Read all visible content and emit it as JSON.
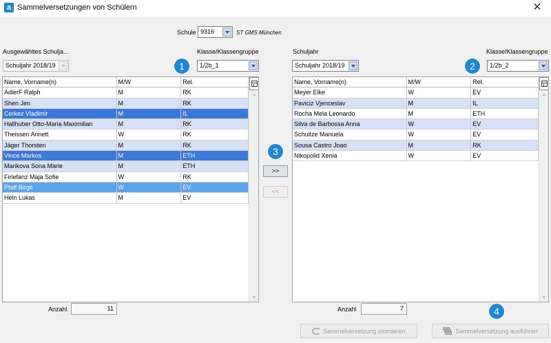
{
  "window": {
    "title": "Sammelversetzungen von Schülern",
    "app_icon_letter": "a",
    "close_glyph": "✕"
  },
  "school": {
    "label": "Schule",
    "value": "9316",
    "name": "ST GMS München"
  },
  "left": {
    "year_label": "Ausgewähltes Schulja...",
    "year_value": "Schuljahr 2018/19",
    "class_label": "Klasse/Klassengruppe",
    "class_value": "1/2b_1",
    "columns": [
      "Name, Vorname(n)",
      "M/W",
      "Rel."
    ],
    "rows": [
      {
        "name": "AdlerF Ralph",
        "mw": "M",
        "rel": "RK",
        "state": "white"
      },
      {
        "name": "Shen Jen",
        "mw": "M",
        "rel": "RK",
        "state": "light"
      },
      {
        "name": "Cerkez Vladimir",
        "mw": "M",
        "rel": "IL",
        "state": "sel"
      },
      {
        "name": "Hallhuber Otto-Maria Maximilian",
        "mw": "M",
        "rel": "RK",
        "state": "light"
      },
      {
        "name": "Theissen Annett",
        "mw": "W",
        "rel": "RK",
        "state": "white"
      },
      {
        "name": "Jäger Thorsten",
        "mw": "M",
        "rel": "RK",
        "state": "light"
      },
      {
        "name": "Vince Markos",
        "mw": "M",
        "rel": "ETH",
        "state": "sel"
      },
      {
        "name": "Marikova Sona Marie",
        "mw": "M",
        "rel": "ETH",
        "state": "light"
      },
      {
        "name": "Firlefanz Maja Sofie",
        "mw": "W",
        "rel": "RK",
        "state": "white"
      },
      {
        "name": "Pfaff Birgit",
        "mw": "W",
        "rel": "EV",
        "state": "focus"
      },
      {
        "name": "Hein Lukas",
        "mw": "M",
        "rel": "EV",
        "state": "white"
      }
    ],
    "count_label": "Anzahl",
    "count_value": "11"
  },
  "right": {
    "year_label": "Schuljahr",
    "year_value": "Schuljahr 2018/19",
    "class_label": "Klasse/Klassengruppe",
    "class_value": "1/2b_2",
    "columns": [
      "Name, Vorname(n)",
      "M/W",
      "Rel."
    ],
    "rows": [
      {
        "name": "Meyer Elke",
        "mw": "W",
        "rel": "EV",
        "state": "white"
      },
      {
        "name": "Paviciz Vjenceslav",
        "mw": "M",
        "rel": "IL",
        "state": "light"
      },
      {
        "name": "Rocha Mela Leonardo",
        "mw": "M",
        "rel": "ETH",
        "state": "white"
      },
      {
        "name": "Silva de Barbossa Anna",
        "mw": "W",
        "rel": "EV",
        "state": "light"
      },
      {
        "name": "Schultze Manuela",
        "mw": "W",
        "rel": "EV",
        "state": "white"
      },
      {
        "name": "Sousa Castro Joao",
        "mw": "M",
        "rel": "RK",
        "state": "light"
      },
      {
        "name": "Nikopolid Xenia",
        "mw": "W",
        "rel": "EV",
        "state": "white"
      }
    ],
    "count_label": "Anzahl",
    "count_value": "7"
  },
  "transfer": {
    "move_right": ">>",
    "move_left": "<<"
  },
  "actions": {
    "cancel": "Sammelversetzung stornieren",
    "execute": "Sammelversetzung ausführen"
  },
  "badges": [
    "1",
    "2",
    "3",
    "4"
  ],
  "colors": {
    "selected_row": "#3c78d8",
    "focused_row": "#5ba3ec",
    "alt_row": "#d6e1f5",
    "badge": "#1f86d6"
  }
}
